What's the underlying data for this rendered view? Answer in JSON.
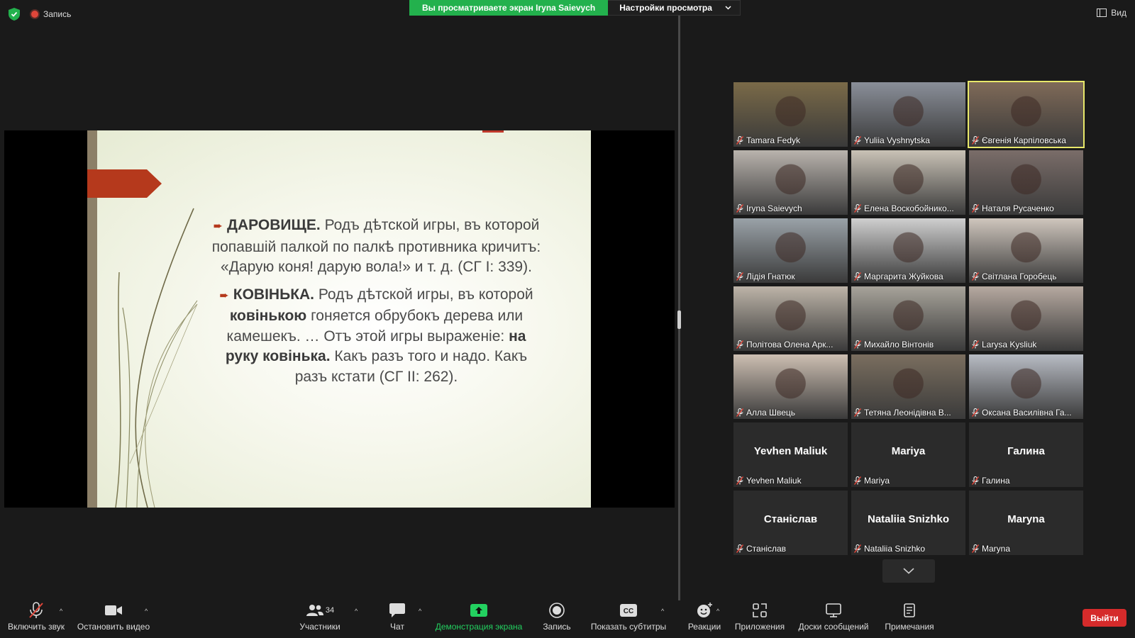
{
  "topbar": {
    "recording_label": "Запись",
    "share_banner": "Вы просматриваете экран Iryna Saievych",
    "view_settings": "Настройки просмотра",
    "view_label": "Вид"
  },
  "slide": {
    "para1_head": "ДАРОВИЩЕ.",
    "para1_text": " Родъ дѣтской игры, въ которой попавшій палкой по палкѣ противника кричитъ: «Дарую коня! дарую вола!» и т. д. (СГ І: 339).",
    "para2_head": "КОВІНЬКА.",
    "para2_text_a": "  Родъ дѣтской игры, въ которой ",
    "para2_bold_a": "ковінькою",
    "para2_text_b": " гоняется обрубокъ дерева или камешекъ. … Отъ этой игры выраженіе: ",
    "para2_bold_b": "на руку ковінька.",
    "para2_text_c": " Какъ разъ того и надо. Какъ разъ кстати (СГ ІІ: 262)."
  },
  "participants": [
    {
      "name": "Tamara Fedyk",
      "big": "",
      "color": "#7a6a48"
    },
    {
      "name": "Yuliia Vyshnytska",
      "big": "",
      "color": "#8a8f99"
    },
    {
      "name": "Євгенія Карпіловська",
      "big": "",
      "color": "#7f6a58",
      "active": true
    },
    {
      "name": "Iryna Saievych",
      "big": "",
      "color": "#b9b3ad"
    },
    {
      "name": "Елена Воскобойнико...",
      "big": "",
      "color": "#c9c2b6"
    },
    {
      "name": "Наталя Русаченко",
      "big": "",
      "color": "#7a6d69"
    },
    {
      "name": "Лідія Гнатюк",
      "big": "",
      "color": "#9aa2a8"
    },
    {
      "name": "Маргарита Жуйкова",
      "big": "",
      "color": "#cfcfcf"
    },
    {
      "name": "Світлана Горобець",
      "big": "",
      "color": "#cfc6bd"
    },
    {
      "name": "Політова Олена Арк...",
      "big": "",
      "color": "#bdb4a8"
    },
    {
      "name": "Михайло Вінтонів",
      "big": "",
      "color": "#a7a39a"
    },
    {
      "name": "Larysa Kysliuk",
      "big": "",
      "color": "#b6a9a0"
    },
    {
      "name": "Алла Швець",
      "big": "",
      "color": "#cdbfb2"
    },
    {
      "name": "Тетяна Леонідівна В...",
      "big": "",
      "color": "#7a6e5f"
    },
    {
      "name": "Оксана Василівна Га...",
      "big": "",
      "color": "#b8bcc4"
    },
    {
      "name": "Yevhen Maliuk",
      "big": "Yevhen Maliuk",
      "color": "#2b2b2b"
    },
    {
      "name": "Mariya",
      "big": "Mariya",
      "color": "#2b2b2b"
    },
    {
      "name": "Галина",
      "big": "Галина",
      "color": "#2b2b2b"
    },
    {
      "name": "Станіслав",
      "big": "Станіслав",
      "color": "#2b2b2b"
    },
    {
      "name": "Nataliia Snizhko",
      "big": "Nataliia Snizhko",
      "color": "#2b2b2b"
    },
    {
      "name": "Maryna",
      "big": "Maryna",
      "color": "#2b2b2b"
    }
  ],
  "toolbar": {
    "unmute": "Включить звук",
    "stop_video": "Остановить видео",
    "participants": "Участники",
    "participants_count": "34",
    "chat": "Чат",
    "share_screen": "Демонстрация экрана",
    "record": "Запись",
    "captions": "Показать субтитры",
    "reactions": "Реакции",
    "apps": "Приложения",
    "whiteboards": "Доски сообщений",
    "notes": "Примечания",
    "leave": "Выйти",
    "cc": "CC"
  }
}
